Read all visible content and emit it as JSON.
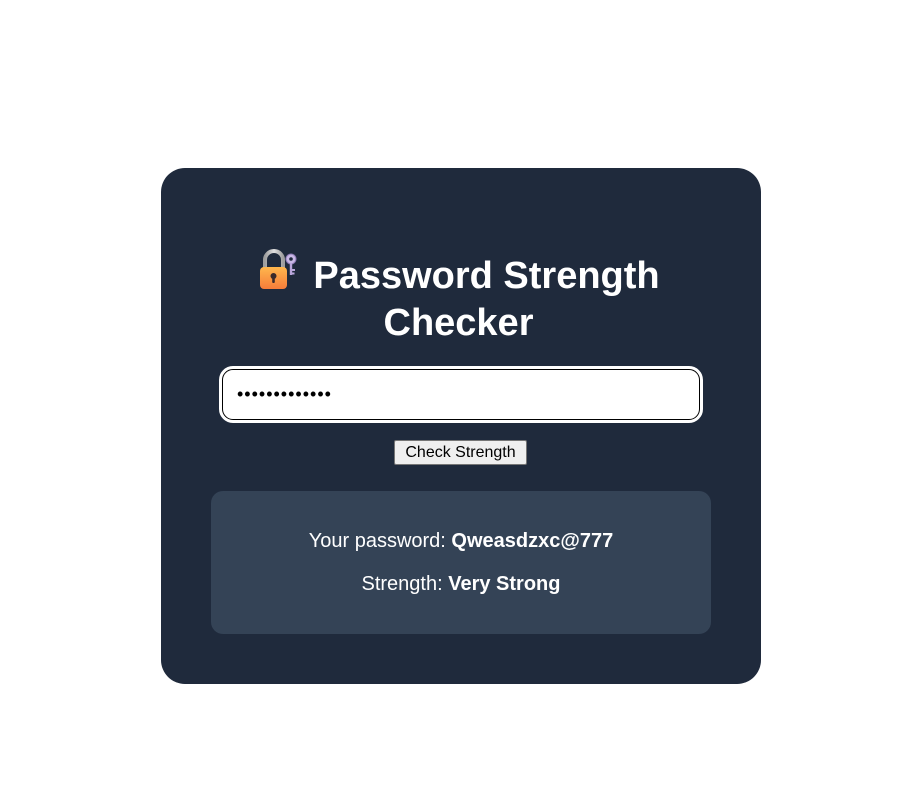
{
  "header": {
    "icon": "locked-with-key-icon",
    "title_line1": "Password Strength",
    "title_line2": "Checker"
  },
  "input": {
    "value": "Qweasdzxc@777",
    "type": "password"
  },
  "button": {
    "label": "Check Strength"
  },
  "result": {
    "password_label": "Your password:",
    "password_value": "Qweasdzxc@777",
    "strength_label": "Strength:",
    "strength_value": "Very Strong"
  },
  "colors": {
    "card_bg": "#1f2a3c",
    "result_bg": "#344356",
    "text": "#ffffff"
  }
}
